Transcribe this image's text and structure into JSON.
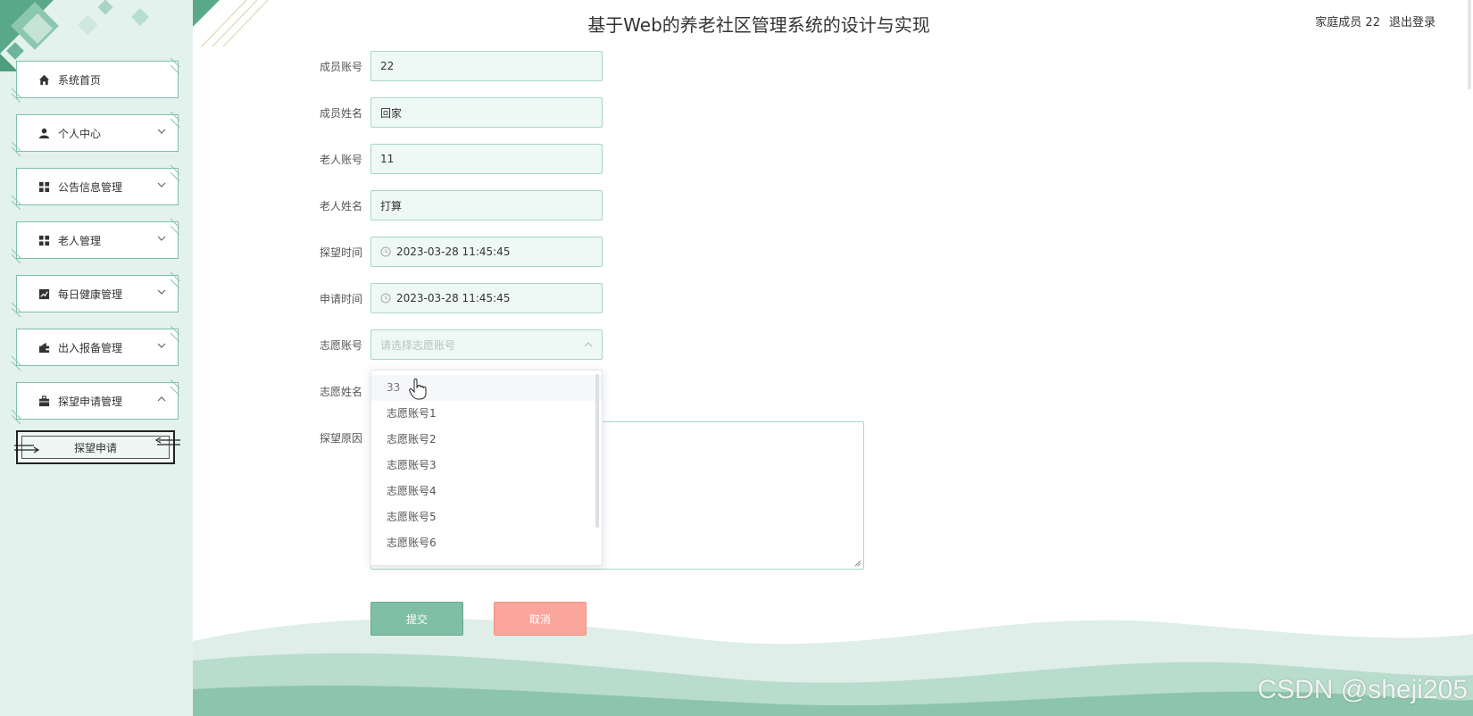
{
  "header": {
    "title": "基于Web的养老社区管理系统的设计与实现",
    "user_label": "家庭成员 22",
    "logout": "退出登录"
  },
  "sidebar": {
    "items": [
      {
        "label": "系统首页",
        "icon": "home-icon",
        "chevron": "none"
      },
      {
        "label": "个人中心",
        "icon": "user-icon",
        "chevron": "down"
      },
      {
        "label": "公告信息管理",
        "icon": "grid-icon",
        "chevron": "down"
      },
      {
        "label": "老人管理",
        "icon": "grid-icon",
        "chevron": "down"
      },
      {
        "label": "每日健康管理",
        "icon": "chart-icon",
        "chevron": "down"
      },
      {
        "label": "出入报备管理",
        "icon": "wallet-icon",
        "chevron": "down"
      },
      {
        "label": "探望申请管理",
        "icon": "briefcase-icon",
        "chevron": "up"
      }
    ],
    "sub_item": "探望申请"
  },
  "form": {
    "member_account": {
      "label": "成员账号",
      "value": "22"
    },
    "member_name": {
      "label": "成员姓名",
      "value": "回家"
    },
    "elder_account": {
      "label": "老人账号",
      "value": "11"
    },
    "elder_name": {
      "label": "老人姓名",
      "value": "打算"
    },
    "visit_time": {
      "label": "探望时间",
      "value": "2023-03-28 11:45:45"
    },
    "apply_time": {
      "label": "申请时间",
      "value": "2023-03-28 11:45:45"
    },
    "volunteer_account": {
      "label": "志愿账号",
      "placeholder": "请选择志愿账号"
    },
    "volunteer_name": {
      "label": "志愿姓名"
    },
    "visit_reason": {
      "label": "探望原因"
    }
  },
  "dropdown": {
    "options": [
      "33",
      "志愿账号1",
      "志愿账号2",
      "志愿账号3",
      "志愿账号4",
      "志愿账号5",
      "志愿账号6"
    ]
  },
  "buttons": {
    "submit": "提交",
    "cancel": "取消"
  },
  "watermark": "CSDN @sheji205",
  "colors": {
    "accent": "#7fbfa6",
    "cancel": "#fba69d",
    "sidebar_bg": "#e3f2ec",
    "field_border": "#a9d8c6"
  }
}
